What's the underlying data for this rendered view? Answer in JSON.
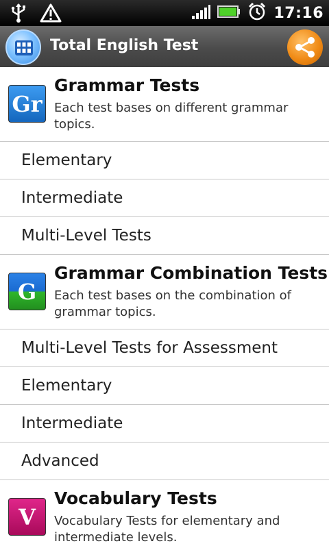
{
  "status_bar": {
    "time": "17:16",
    "icons": [
      "usb-icon",
      "warning-icon",
      "signal-icon",
      "battery-icon",
      "alarm-icon"
    ]
  },
  "title_bar": {
    "title": "Total English Test",
    "left_icon": "grid-icon",
    "right_icon": "share-icon"
  },
  "sections": [
    {
      "icon_letter": "Gr",
      "title": "Grammar Tests",
      "description": "Each test bases on different grammar topics.",
      "items": [
        "Elementary",
        "Intermediate",
        "Multi-Level Tests"
      ]
    },
    {
      "icon_letter": "G",
      "title": "Grammar Combination Tests",
      "description": "Each test bases on the combination of grammar topics.",
      "items": [
        "Multi-Level Tests for Assessment",
        "Elementary",
        "Intermediate",
        "Advanced"
      ]
    },
    {
      "icon_letter": "V",
      "title": "Vocabulary Tests",
      "description": "Vocabulary Tests for elementary and intermediate levels.",
      "items": []
    }
  ],
  "colors": {
    "grammar_icon": "#1a78d0",
    "combination_icon_top": "#1c73d9",
    "combination_icon_bottom": "#2fb52a",
    "vocabulary_icon": "#c0106a",
    "divider": "#c8c8c8"
  }
}
